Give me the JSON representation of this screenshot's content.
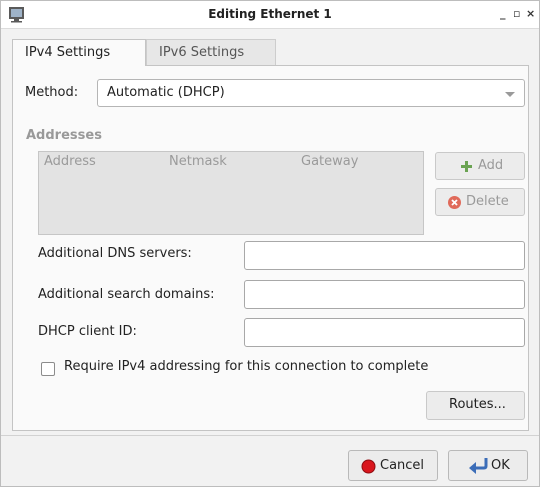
{
  "window": {
    "title": "Editing Ethernet 1"
  },
  "window_controls": {
    "minimize": "_",
    "maximize": "▫",
    "close": "×"
  },
  "tabs": [
    {
      "label": "IPv4 Settings"
    },
    {
      "label": "IPv6 Settings"
    }
  ],
  "ipv4": {
    "method_label": "Method:",
    "method_value": "Automatic (DHCP)",
    "addresses_title": "Addresses",
    "address_columns": [
      "Address",
      "Netmask",
      "Gateway"
    ],
    "add_label": "Add",
    "delete_label": "Delete",
    "dns_label": "Additional DNS servers:",
    "dns_value": "",
    "search_label": "Additional search domains:",
    "search_value": "",
    "dhcp_label": "DHCP client ID:",
    "dhcp_value": "",
    "require_label": "Require IPv4 addressing for this connection to complete",
    "routes_label": "Routes..."
  },
  "buttons": {
    "cancel": "Cancel",
    "ok": "OK"
  },
  "colors": {
    "cancel_red": "#d9161d",
    "add_green": "#6aa352",
    "delete_red": "#e06a5a",
    "ok_blue": "#3b6db8"
  }
}
